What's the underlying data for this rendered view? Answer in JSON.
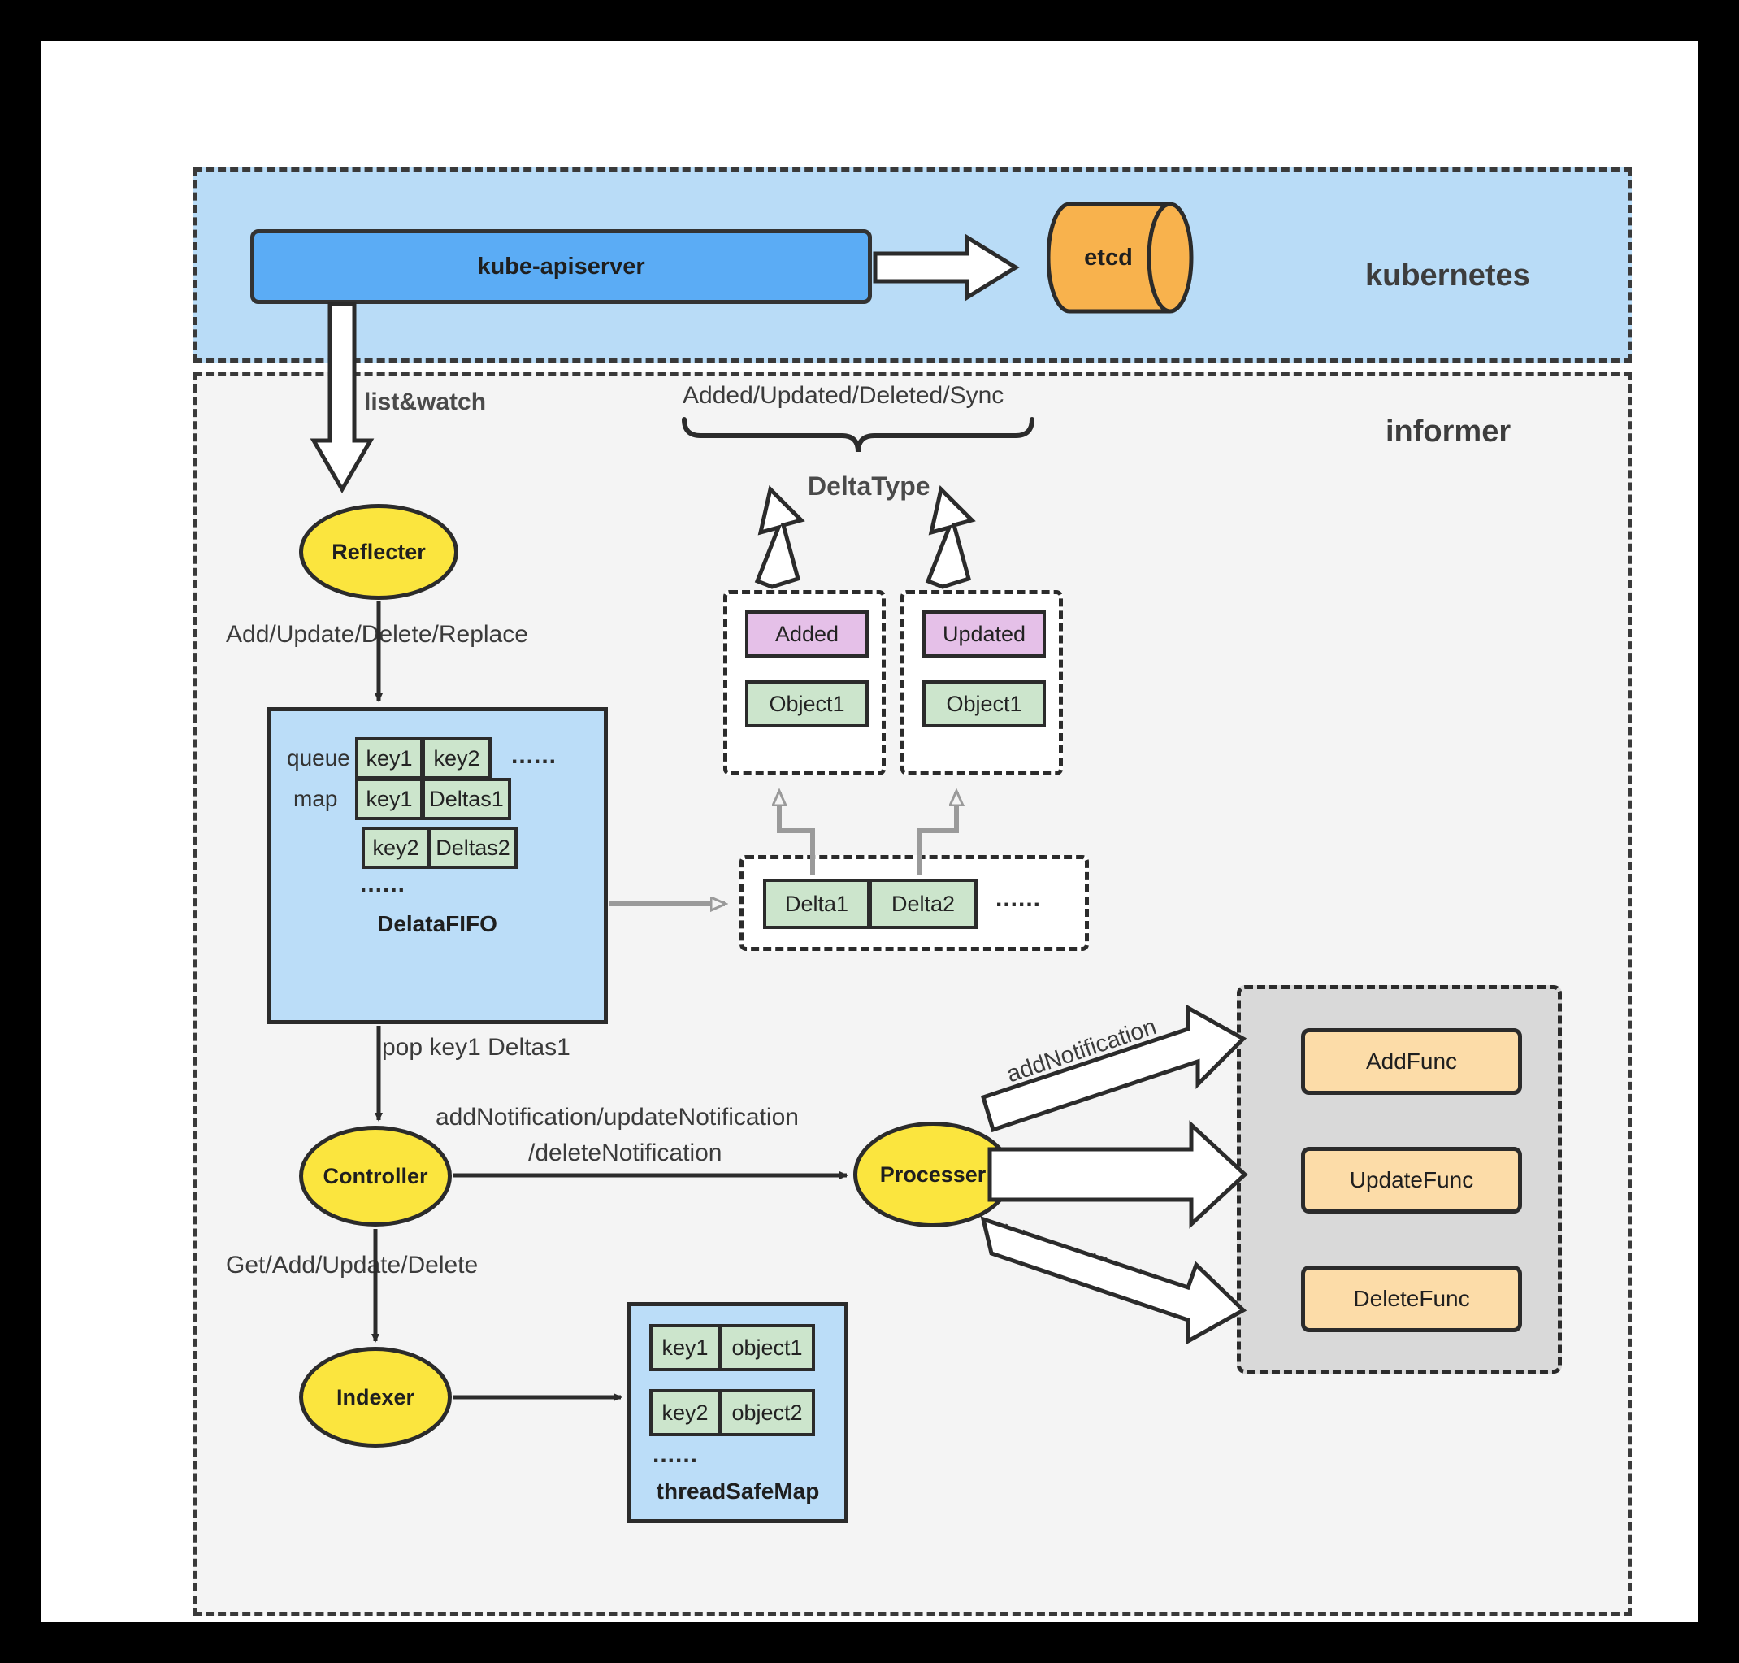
{
  "diagram": {
    "zones": {
      "kubernetes_label": "kubernetes",
      "informer_label": "informer"
    },
    "nodes": {
      "apiserver": "kube-apiserver",
      "etcd": "etcd",
      "reflecter": "Reflecter",
      "controller": "Controller",
      "indexer": "Indexer",
      "processer": "Processer"
    },
    "delta_fifo": {
      "title": "DelataFIFO",
      "queue_label": "queue",
      "map_label": "map",
      "queue_cells": [
        "key1",
        "key2"
      ],
      "queue_ellipsis": "......",
      "map_row1": [
        "key1",
        "Deltas1"
      ],
      "map_row2": [
        "key2",
        "Deltas2"
      ],
      "map_ellipsis": "......"
    },
    "thread_safe_map": {
      "title": "threadSafeMap",
      "row1": [
        "key1",
        "object1"
      ],
      "row2": [
        "key2",
        "object2"
      ],
      "ellipsis": "......"
    },
    "delta_type": {
      "brace_label": "Added/Updated/Deleted/Sync",
      "name": "DeltaType",
      "added_box": {
        "type": "Added",
        "object": "Object1"
      },
      "updated_box": {
        "type": "Updated",
        "object": "Object1"
      },
      "delta_list": [
        "Delta1",
        "Delta2"
      ],
      "delta_list_ellipsis": "......"
    },
    "handlers": {
      "add": "AddFunc",
      "update": "UpdateFunc",
      "delete": "DeleteFunc"
    },
    "edges": {
      "list_watch": "list&watch",
      "reflecter_to_fifo": "Add/Update/Delete/Replace",
      "fifo_to_controller": "pop key1 Deltas1",
      "controller_to_processer": "addNotification/updateNotification\n/deleteNotification",
      "controller_to_processer_line1": "addNotification/updateNotification",
      "controller_to_processer_line2": "/deleteNotification",
      "controller_to_indexer": "Get/Add/Update/Delete",
      "add_notification": "addNotification",
      "update_notification": "updateNotification",
      "delete_notification": "deleteNotification"
    },
    "colors": {
      "zone_k8s_bg": "#b9dcf7",
      "zone_informer_bg": "#f4f4f4",
      "apiserver_blue": "#5bacf5",
      "etcd_orange": "#f8b24d",
      "node_yellow": "#fbe53e",
      "panel_blue": "#bbddf8",
      "cell_green": "#cce5cc",
      "tag_purple": "#e5c0e8",
      "func_orange": "#fcdca8",
      "handler_gray": "#d9d9d9",
      "stroke_dark": "#2b2b2b",
      "stroke_gray": "#9a9a9a"
    }
  }
}
